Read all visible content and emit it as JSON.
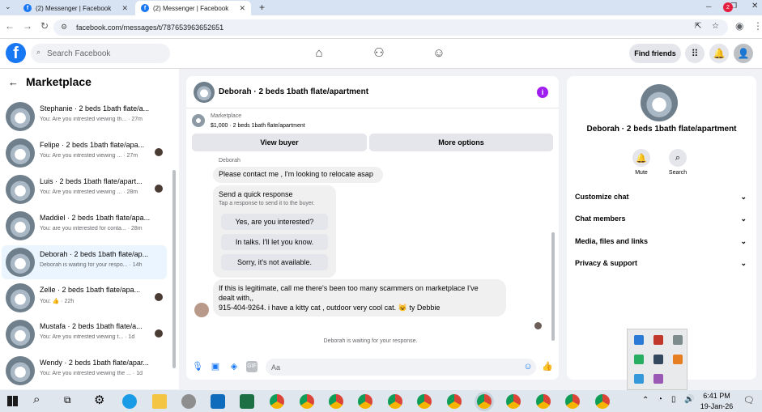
{
  "browser": {
    "tabs": [
      {
        "label": "(2) Messenger | Facebook",
        "active": false
      },
      {
        "label": "(2) Messenger | Facebook",
        "active": true
      }
    ],
    "url": "facebook.com/messages/t/787653963652651"
  },
  "topbar": {
    "search_placeholder": "Search Facebook",
    "find_friends": "Find friends",
    "notification_count": "2"
  },
  "sidebar": {
    "title": "Marketplace",
    "conversations": [
      {
        "title": "Stephanie · 2 beds 1bath flate/a...",
        "preview": "You: Are you intrested viewing th... · 27m",
        "selected": false,
        "dot": false
      },
      {
        "title": "Felipe · 2 beds 1bath flate/apa...",
        "preview": "You: Are you intrested viewing ... · 27m",
        "selected": false,
        "dot": true
      },
      {
        "title": "Luis · 2 beds 1bath flate/apart...",
        "preview": "You: Are you intrested viewing ... · 28m",
        "selected": false,
        "dot": true
      },
      {
        "title": "Maddiel · 2 beds 1bath flate/apa...",
        "preview": "You: are you interested for conta... · 28m",
        "selected": false,
        "dot": false
      },
      {
        "title": "Deborah · 2 beds 1bath flate/ap...",
        "preview": "Deborah is waiting for your respo... · 14h",
        "selected": true,
        "dot": false
      },
      {
        "title": "Zelle · 2 beds 1bath flate/apa...",
        "preview": "You: 👍 · 22h",
        "selected": false,
        "dot": true
      },
      {
        "title": "Mustafa · 2 beds 1bath flate/a...",
        "preview": "You: Are you intrested viewing t... · 1d",
        "selected": false,
        "dot": true
      },
      {
        "title": "Wendy · 2 beds 1bath flate/apar...",
        "preview": "You: Are you intrested viewing the ... · 1d",
        "selected": false,
        "dot": false
      }
    ]
  },
  "chat": {
    "title": "Deborah · 2 beds 1bath flate/apartment",
    "listing_label": "Marketplace",
    "listing_price": "$1,000 · 2 beds 1bath flate/apartment",
    "view_buyer": "View buyer",
    "more_options": "More options",
    "sender": "Deborah",
    "message1": "Please contact me , I'm looking to relocate asap",
    "quick_response_title": "Send a quick response",
    "quick_response_sub": "Tap a response to send it to the buyer.",
    "quick_responses": [
      "Yes, are you interested?",
      "In talks. I'll let you know.",
      "Sorry, it's not available."
    ],
    "message2_line1": "If this is legitimate, call me there's been too many scammers on marketplace I've",
    "message2_line2": "dealt with,,",
    "message2_line3": "915-404-9264. i have a kitty cat , outdoor very cool cat. 😺 ty Debbie",
    "waiting_text": "Deborah is waiting for your response.",
    "composer_placeholder": "Aa"
  },
  "rightpanel": {
    "title": "Deborah · 2 beds 1bath flate/apartment",
    "mute": "Mute",
    "search": "Search",
    "rows": [
      "Customize chat",
      "Chat members",
      "Media, files and links",
      "Privacy & support"
    ]
  },
  "taskbar": {
    "time": "6:41 PM",
    "date": "19-Jan-26"
  },
  "colors": {
    "brand": "#1877f2",
    "info_purple": "#a01ff0",
    "badge_red": "#e41e3f",
    "selected_row": "#ebf5ff"
  }
}
